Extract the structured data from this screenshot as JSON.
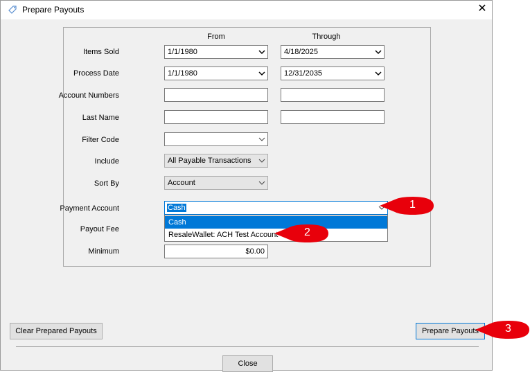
{
  "window": {
    "title": "Prepare Payouts",
    "close_glyph": "✕"
  },
  "headers": {
    "from": "From",
    "through": "Through"
  },
  "labels": {
    "items_sold": "Items Sold",
    "process_date": "Process Date",
    "account_numbers": "Account Numbers",
    "last_name": "Last Name",
    "filter_code": "Filter Code",
    "include": "Include",
    "sort_by": "Sort By",
    "payment_account": "Payment Account",
    "payout_fee": "Payout Fee",
    "minimum": "Minimum"
  },
  "fields": {
    "items_sold_from": "1/1/1980",
    "items_sold_through": "4/18/2025",
    "process_date_from": "1/1/1980",
    "process_date_through": "12/31/2035",
    "account_numbers_from": "",
    "account_numbers_through": "",
    "last_name_from": "",
    "last_name_through": "",
    "filter_code": "",
    "include": "All Payable Transactions",
    "sort_by": "Account",
    "payment_account": "Cash",
    "minimum": "$0.00"
  },
  "payment_account_options": [
    "Cash",
    "ResaleWallet: ACH Test Account"
  ],
  "buttons": {
    "clear_prepared": "Clear Prepared Payouts",
    "prepare": "Prepare Payouts",
    "close": "Close"
  },
  "callouts": [
    "1",
    "2",
    "3"
  ],
  "colors": {
    "selection": "#0078d7",
    "callout": "#e8000b",
    "focus_border": "#0078d7"
  },
  "icons": {
    "window_icon": "tag-icon",
    "dropdown": "chevron-down-icon"
  }
}
